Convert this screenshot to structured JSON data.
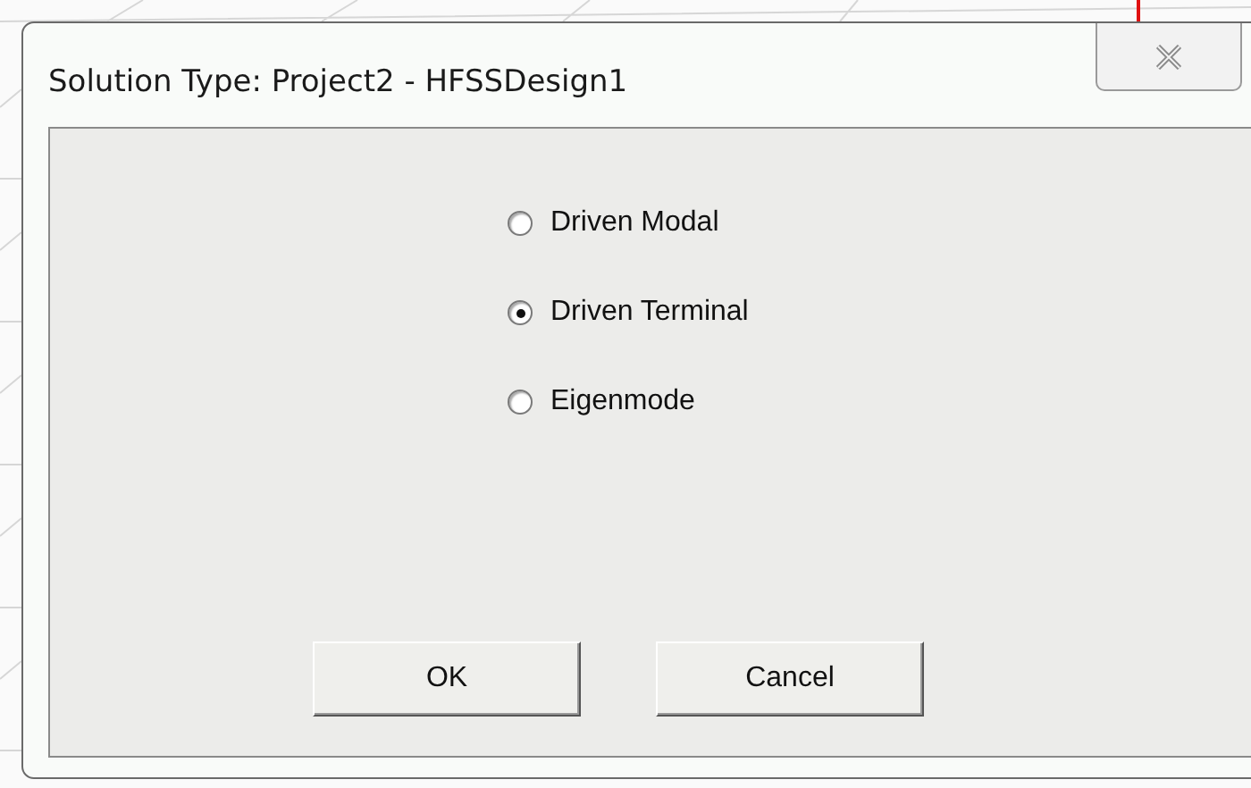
{
  "window": {
    "title": "Solution Type: Project2 - HFSSDesign1"
  },
  "options": [
    {
      "label": "Driven Modal",
      "selected": false
    },
    {
      "label": "Driven Terminal",
      "selected": true
    },
    {
      "label": "Eigenmode",
      "selected": false
    }
  ],
  "buttons": [
    "OK",
    "Cancel"
  ]
}
